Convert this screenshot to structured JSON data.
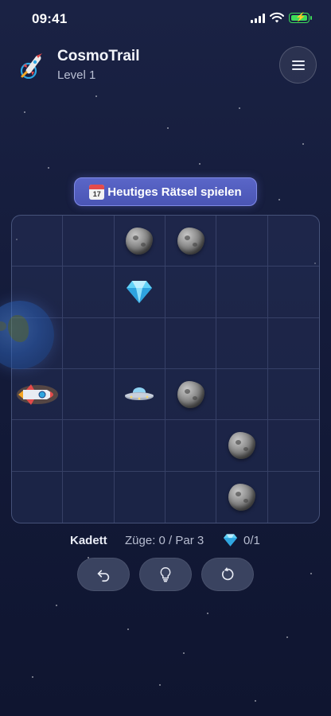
{
  "status_bar": {
    "time": "09:41"
  },
  "header": {
    "app_title": "CosmoTrail",
    "level_label": "Level 1",
    "logo_icon": "rocket-icon",
    "menu_icon": "menu-icon"
  },
  "daily": {
    "label": "Heutiges Rätsel spielen",
    "calendar_day": "17"
  },
  "board": {
    "size": 6,
    "cells": [
      [
        "",
        "",
        "asteroid",
        "asteroid",
        "",
        ""
      ],
      [
        "",
        "",
        "gem",
        "",
        "",
        ""
      ],
      [
        "",
        "",
        "",
        "",
        "",
        ""
      ],
      [
        "rocket",
        "",
        "ufo",
        "asteroid",
        "",
        ""
      ],
      [
        "",
        "",
        "",
        "",
        "asteroid",
        ""
      ],
      [
        "",
        "",
        "",
        "",
        "asteroid",
        ""
      ]
    ]
  },
  "status": {
    "rank": "Kadett",
    "moves": "Züge: 0 / Par 3",
    "gems": "0/1"
  },
  "controls": {
    "undo_icon": "undo-icon",
    "hint_icon": "lightbulb-icon",
    "restart_icon": "restart-icon"
  },
  "colors": {
    "background": "#141b3a",
    "accent": "#5a66c8",
    "battery": "#3ddc5a"
  }
}
